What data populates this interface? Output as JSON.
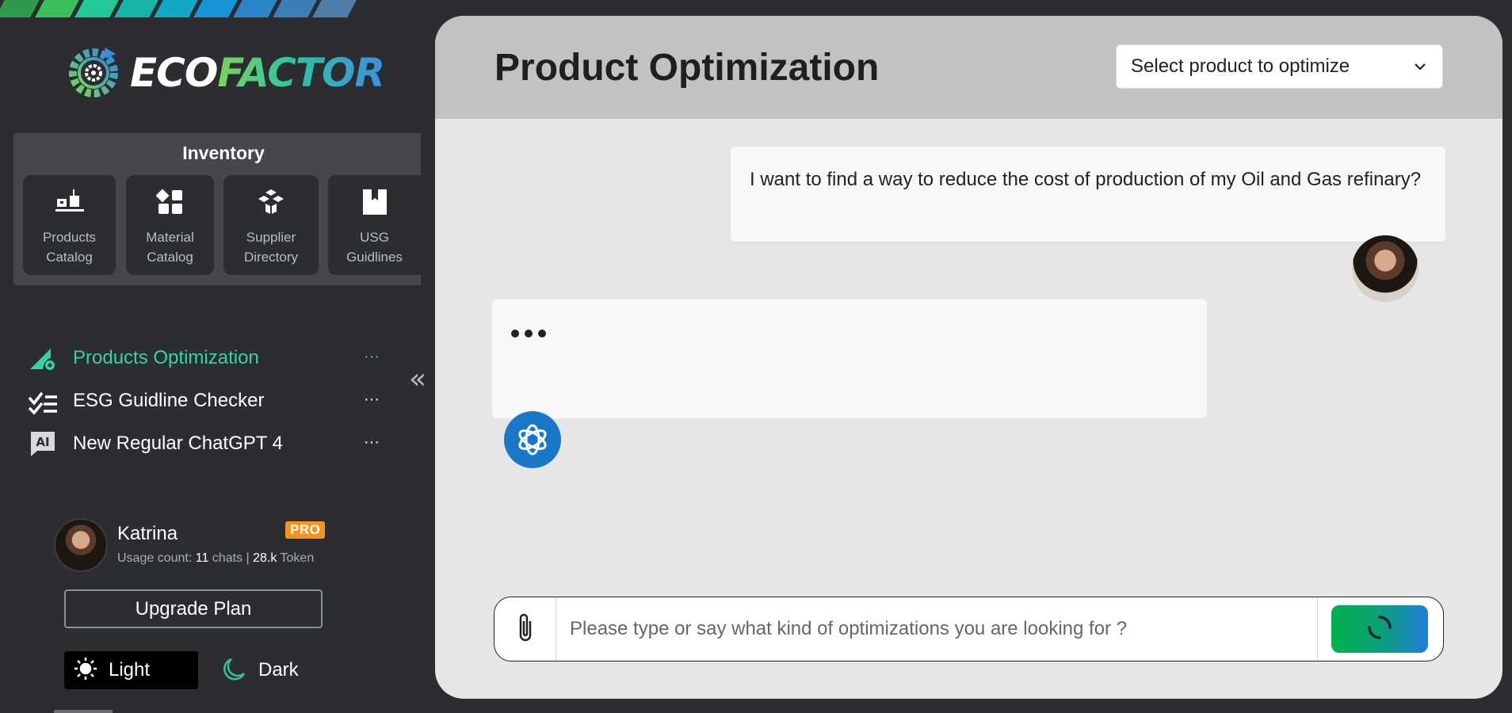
{
  "brand": {
    "logo_part1": "ECO",
    "logo_part2": "FACTOR",
    "stripe_colors": [
      "#2f9a4a",
      "#3bbf5a",
      "#20c997",
      "#17b5a8",
      "#14a8c8",
      "#1794d8",
      "#2b86c7",
      "#3a7fb8",
      "#4f7fa8"
    ]
  },
  "inventory": {
    "title": "Inventory",
    "items": [
      {
        "label": "Products\nCatalog",
        "icon": "products-catalog-icon"
      },
      {
        "label": "Material\nCatalog",
        "icon": "material-catalog-icon"
      },
      {
        "label": "Supplier\nDirectory",
        "icon": "supplier-directory-icon"
      },
      {
        "label": "USG\nGuidlines",
        "icon": "bookmark-icon"
      }
    ]
  },
  "nav": {
    "items": [
      {
        "label": "Products Optimization",
        "icon": "optimization-icon",
        "active": true
      },
      {
        "label": "ESG Guidline Checker",
        "icon": "checklist-icon",
        "active": false
      },
      {
        "label": "New Regular ChatGPT 4",
        "icon": "ai-icon",
        "active": false
      }
    ],
    "more": "···",
    "collapse": "«"
  },
  "user": {
    "name": "Katrina",
    "badge": "PRO",
    "usage_label": "Usage count:",
    "chats_count": "11",
    "chats_label": "chats",
    "separator": "|",
    "tokens": "28.k",
    "tokens_label": "Token"
  },
  "upgrade_label": "Upgrade Plan",
  "theme": {
    "light_label": "Light",
    "dark_label": "Dark"
  },
  "main": {
    "title": "Product Optimization",
    "product_select": "Select product to optimize"
  },
  "chat": {
    "user_message": "I want to find a way to reduce the cost of production of my Oil and Gas refinary?"
  },
  "composer": {
    "placeholder": "Please type or say what kind of optimizations you are looking for ?"
  },
  "colors": {
    "accent": "#34d3a3",
    "sidebar_bg": "#2b2d31",
    "main_bg": "#e6e6e6",
    "header_bg": "#c2c2c2",
    "pro_badge": "#f7931e",
    "bot_avatar": "#1a78c8"
  }
}
